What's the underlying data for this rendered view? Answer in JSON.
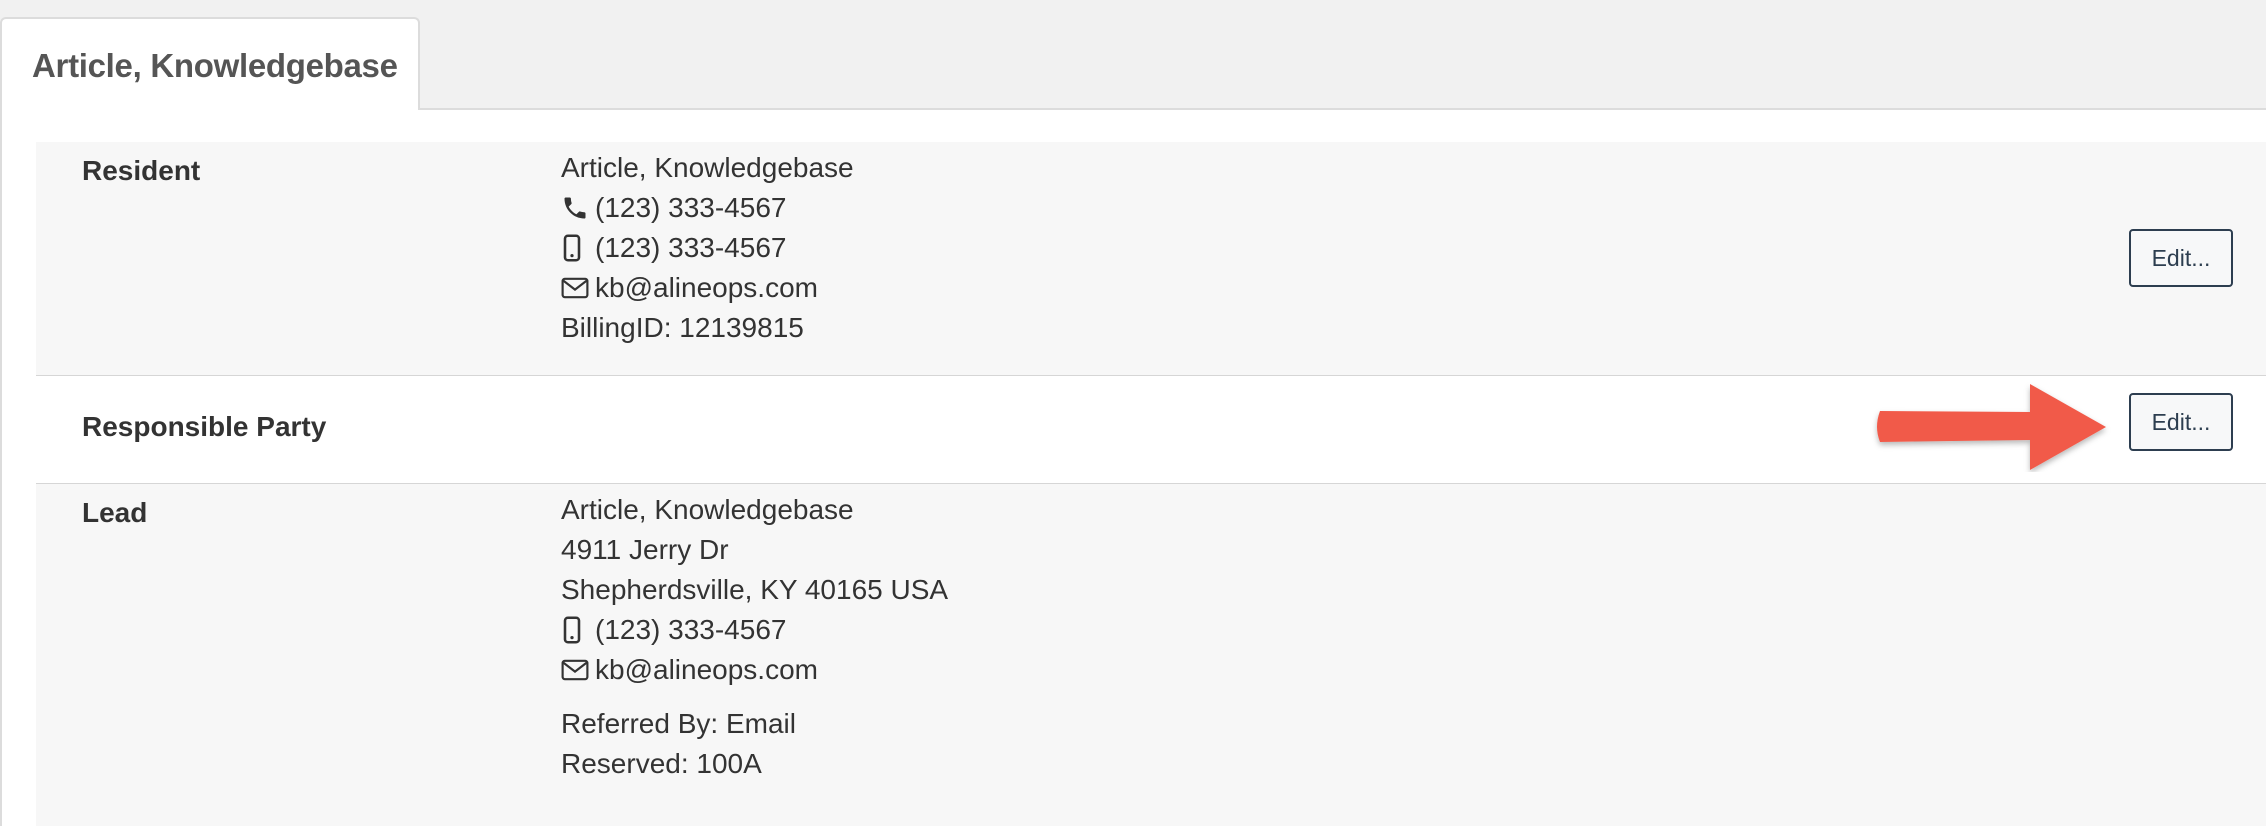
{
  "tab": {
    "label": "Article, Knowledgebase"
  },
  "colors": {
    "button_border": "#2d3e50",
    "arrow": "#f15a4a",
    "row_shaded": "#f7f7f7"
  },
  "resident": {
    "label": "Resident",
    "name": "Article, Knowledgebase",
    "phone": "(123) 333-4567",
    "mobile": "(123) 333-4567",
    "email": "kb@alineops.com",
    "billing": "BillingID: 12139815",
    "edit_label": "Edit..."
  },
  "responsible_party": {
    "label": "Responsible Party",
    "edit_label": "Edit..."
  },
  "lead": {
    "label": "Lead",
    "name": "Article, Knowledgebase",
    "address1": "4911 Jerry Dr",
    "address2": "Shepherdsville, KY 40165 USA",
    "mobile": "(123) 333-4567",
    "email": "kb@alineops.com",
    "referred_by": "Referred By: Email",
    "reserved": "Reserved: 100A"
  },
  "icons": {
    "phone": "phone-icon",
    "mobile": "mobile-phone-icon",
    "email": "envelope-icon",
    "annotation": "red-arrow-annotation"
  }
}
